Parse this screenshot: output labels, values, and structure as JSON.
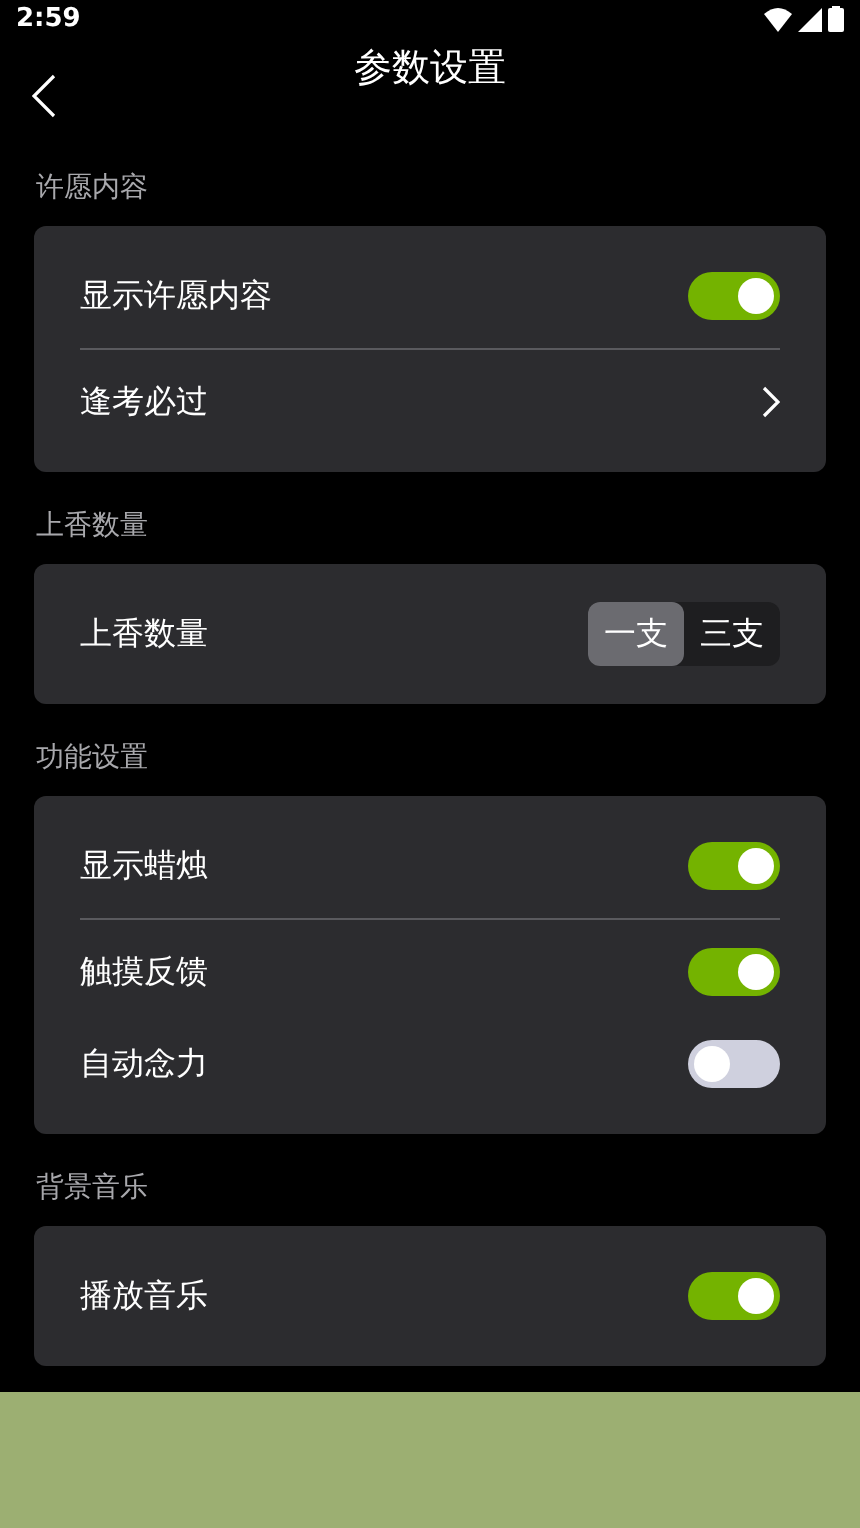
{
  "status_bar": {
    "time": "2:59"
  },
  "header": {
    "title": "参数设置"
  },
  "sections": [
    {
      "title": "许愿内容",
      "rows": [
        {
          "kind": "toggle",
          "label": "显示许愿内容",
          "on": true,
          "divider": true
        },
        {
          "kind": "link",
          "label": "逢考必过"
        }
      ]
    },
    {
      "title": "上香数量",
      "rows": [
        {
          "kind": "segment",
          "label": "上香数量",
          "options": [
            {
              "label": "一支",
              "selected": true
            },
            {
              "label": "三支",
              "selected": false
            }
          ]
        }
      ]
    },
    {
      "title": "功能设置",
      "rows": [
        {
          "kind": "toggle",
          "label": "显示蜡烛",
          "on": true,
          "divider": true
        },
        {
          "kind": "toggle",
          "label": "触摸反馈",
          "on": true
        },
        {
          "kind": "toggle",
          "label": "自动念力",
          "on": false
        }
      ]
    },
    {
      "title": "背景音乐",
      "rows": [
        {
          "kind": "toggle",
          "label": "播放音乐",
          "on": true
        }
      ]
    }
  ]
}
